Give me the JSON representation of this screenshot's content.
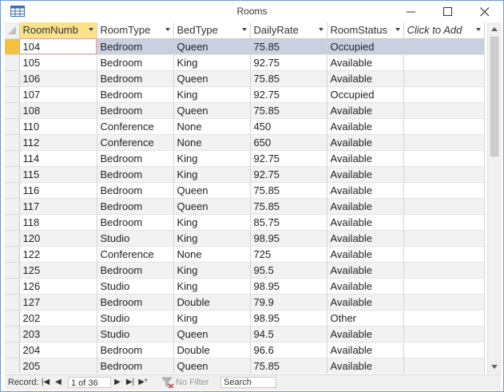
{
  "window": {
    "title": "Rooms",
    "icon": "table-icon"
  },
  "columns": [
    "RoomNumb",
    "RoomType",
    "BedType",
    "DailyRate",
    "RoomStatus",
    "Click to Add"
  ],
  "rows": [
    [
      "104",
      "Bedroom",
      "Queen",
      "75.85",
      "Occupied"
    ],
    [
      "105",
      "Bedroom",
      "King",
      "92.75",
      "Available"
    ],
    [
      "106",
      "Bedroom",
      "Queen",
      "75.85",
      "Available"
    ],
    [
      "107",
      "Bedroom",
      "King",
      "92.75",
      "Occupied"
    ],
    [
      "108",
      "Bedroom",
      "Queen",
      "75.85",
      "Available"
    ],
    [
      "110",
      "Conference",
      "None",
      "450",
      "Available"
    ],
    [
      "112",
      "Conference",
      "None",
      "650",
      "Available"
    ],
    [
      "114",
      "Bedroom",
      "King",
      "92.75",
      "Available"
    ],
    [
      "115",
      "Bedroom",
      "King",
      "92.75",
      "Available"
    ],
    [
      "116",
      "Bedroom",
      "Queen",
      "75.85",
      "Available"
    ],
    [
      "117",
      "Bedroom",
      "Queen",
      "75.85",
      "Available"
    ],
    [
      "118",
      "Bedroom",
      "King",
      "85.75",
      "Available"
    ],
    [
      "120",
      "Studio",
      "King",
      "98.95",
      "Available"
    ],
    [
      "122",
      "Conference",
      "None",
      "725",
      "Available"
    ],
    [
      "125",
      "Bedroom",
      "King",
      "95.5",
      "Available"
    ],
    [
      "126",
      "Studio",
      "King",
      "98.95",
      "Available"
    ],
    [
      "127",
      "Bedroom",
      "Double",
      "79.9",
      "Available"
    ],
    [
      "202",
      "Studio",
      "King",
      "98.95",
      "Other"
    ],
    [
      "203",
      "Studio",
      "Queen",
      "94.5",
      "Available"
    ],
    [
      "204",
      "Bedroom",
      "Double",
      "96.6",
      "Available"
    ],
    [
      "205",
      "Bedroom",
      "Queen",
      "75.85",
      "Available"
    ]
  ],
  "navigation": {
    "record_label": "Record:",
    "position": "1 of 36",
    "filter_label": "No Filter",
    "search_label": "Search"
  },
  "colors": {
    "selected_header": "#f8e38a",
    "selected_row": "#c9d1e0",
    "row_selector_current": "#f5c23c"
  }
}
